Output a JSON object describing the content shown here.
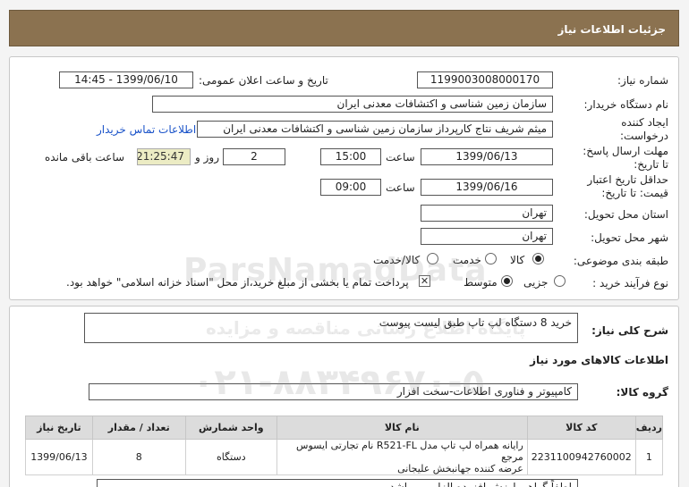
{
  "header": {
    "title": "جزئیات اطلاعات نیاز"
  },
  "form": {
    "need_number_label": "شماره نیاز:",
    "need_number": "1199003008000170",
    "announce_label": "تاریخ و ساعت اعلان عمومی:",
    "announce_value": "1399/06/10 - 14:45",
    "buyer_org_label": "نام دستگاه خریدار:",
    "buyer_org": "سازمان زمین شناسی و اکتشافات معدنی ایران",
    "creator_label_1": "ایجاد کننده",
    "creator_label_2": "درخواست:",
    "creator": "میثم شریف نتاج کارپرداز سازمان زمین شناسی و اکتشافات معدنی ایران",
    "contact_link": "اطلاعات تماس خریدار",
    "deadline_label_1": "مهلت ارسال پاسخ:",
    "deadline_label_2": "تا تاریخ:",
    "deadline_date": "1399/06/13",
    "time_label": "ساعت",
    "deadline_time": "15:00",
    "days_value": "2",
    "days_label": "روز و",
    "remaining_time": "21:25:47",
    "remaining_label": "ساعت باقی مانده",
    "validity_label_1": "حداقل تاریخ اعتبار",
    "validity_label_2": "قیمت: تا تاریخ:",
    "validity_date": "1399/06/16",
    "validity_time_label": "ساعت",
    "validity_time": "09:00",
    "province_label": "استان محل تحویل:",
    "province": "تهران",
    "city_label": "شهر محل تحویل:",
    "city": "تهران",
    "category_label": "طبقه بندی موضوعی:",
    "category_options": [
      "کالا",
      "خدمت",
      "کالا/خدمت"
    ],
    "process_label": "نوع فرآیند خرید :",
    "process_options": [
      "جزیی",
      "متوسط"
    ],
    "payment_note": "پرداخت تمام یا بخشی از مبلغ خرید،از محل \"اسناد خزانه اسلامی\" خواهد بود."
  },
  "details": {
    "summary_label": "شرح کلی نیاز:",
    "summary": "خرید 8 دستگاه لپ تاپ طبق لیست پیوست",
    "goods_info_title": "اطلاعات کالاهای مورد نیاز",
    "group_label": "گروه کالا:",
    "group": "کامپیوتر و فناوری اطلاعات-سخت افزار"
  },
  "table": {
    "headers": [
      "ردیف",
      "کد کالا",
      "نام کالا",
      "واحد شمارش",
      "تعداد / مقدار",
      "تاریخ نیاز"
    ],
    "rows": [
      {
        "row": "1",
        "code": "2231100942760002",
        "name_1": "رایانه همراه لپ تاپ مدل R521-FL نام تجارتی ایسوس مرجع",
        "name_2": "عرضه کننده جهانبخش علیجانی",
        "unit": "دستگاه",
        "qty": "8",
        "date": "1399/06/13"
      }
    ]
  },
  "bottom_note": "لطفاً گواهی ارزش افزوده الزامی میباشد",
  "watermark": {
    "line1": "ParsNamadData",
    "line2": "پایگاه اطلاع رسانی مناقصه و مزایده",
    "line3": "۰۲۱-۸۸۳۴۹۶۷۰-۵"
  }
}
